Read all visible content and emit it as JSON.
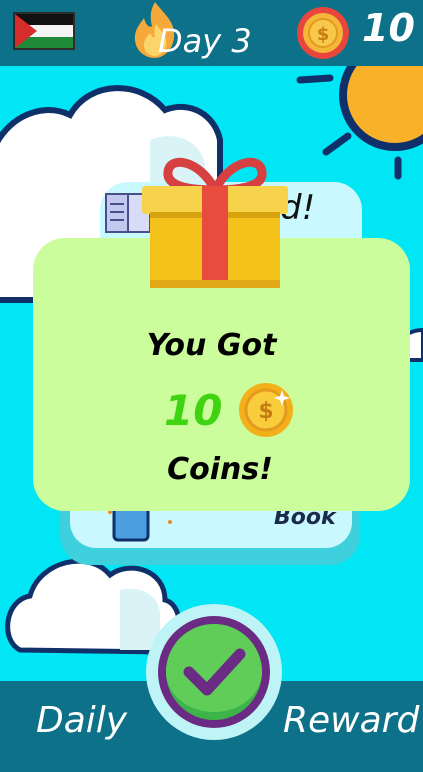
{
  "header": {
    "day_label": "Day 3",
    "coins": "10"
  },
  "background_card": {
    "title_fragment": "d!",
    "book_label": "Book"
  },
  "popup": {
    "line1": "You Got",
    "amount": "10",
    "line3": "Coins!"
  },
  "footer": {
    "left_label": "Daily",
    "right_label": "Reward"
  },
  "colors": {
    "top_bar": "#0c7189",
    "sky": "#00e6f5",
    "popup_bg": "#ccfd9c",
    "amount_green": "#3fd312",
    "check_green": "#4fc84e",
    "check_ring": "#6b2a83"
  },
  "icons": [
    "palestine-flag-icon",
    "flame-icon",
    "coin-icon",
    "sun-icon",
    "cloud-icon",
    "gift-icon",
    "book-icon",
    "checkmark-icon"
  ]
}
